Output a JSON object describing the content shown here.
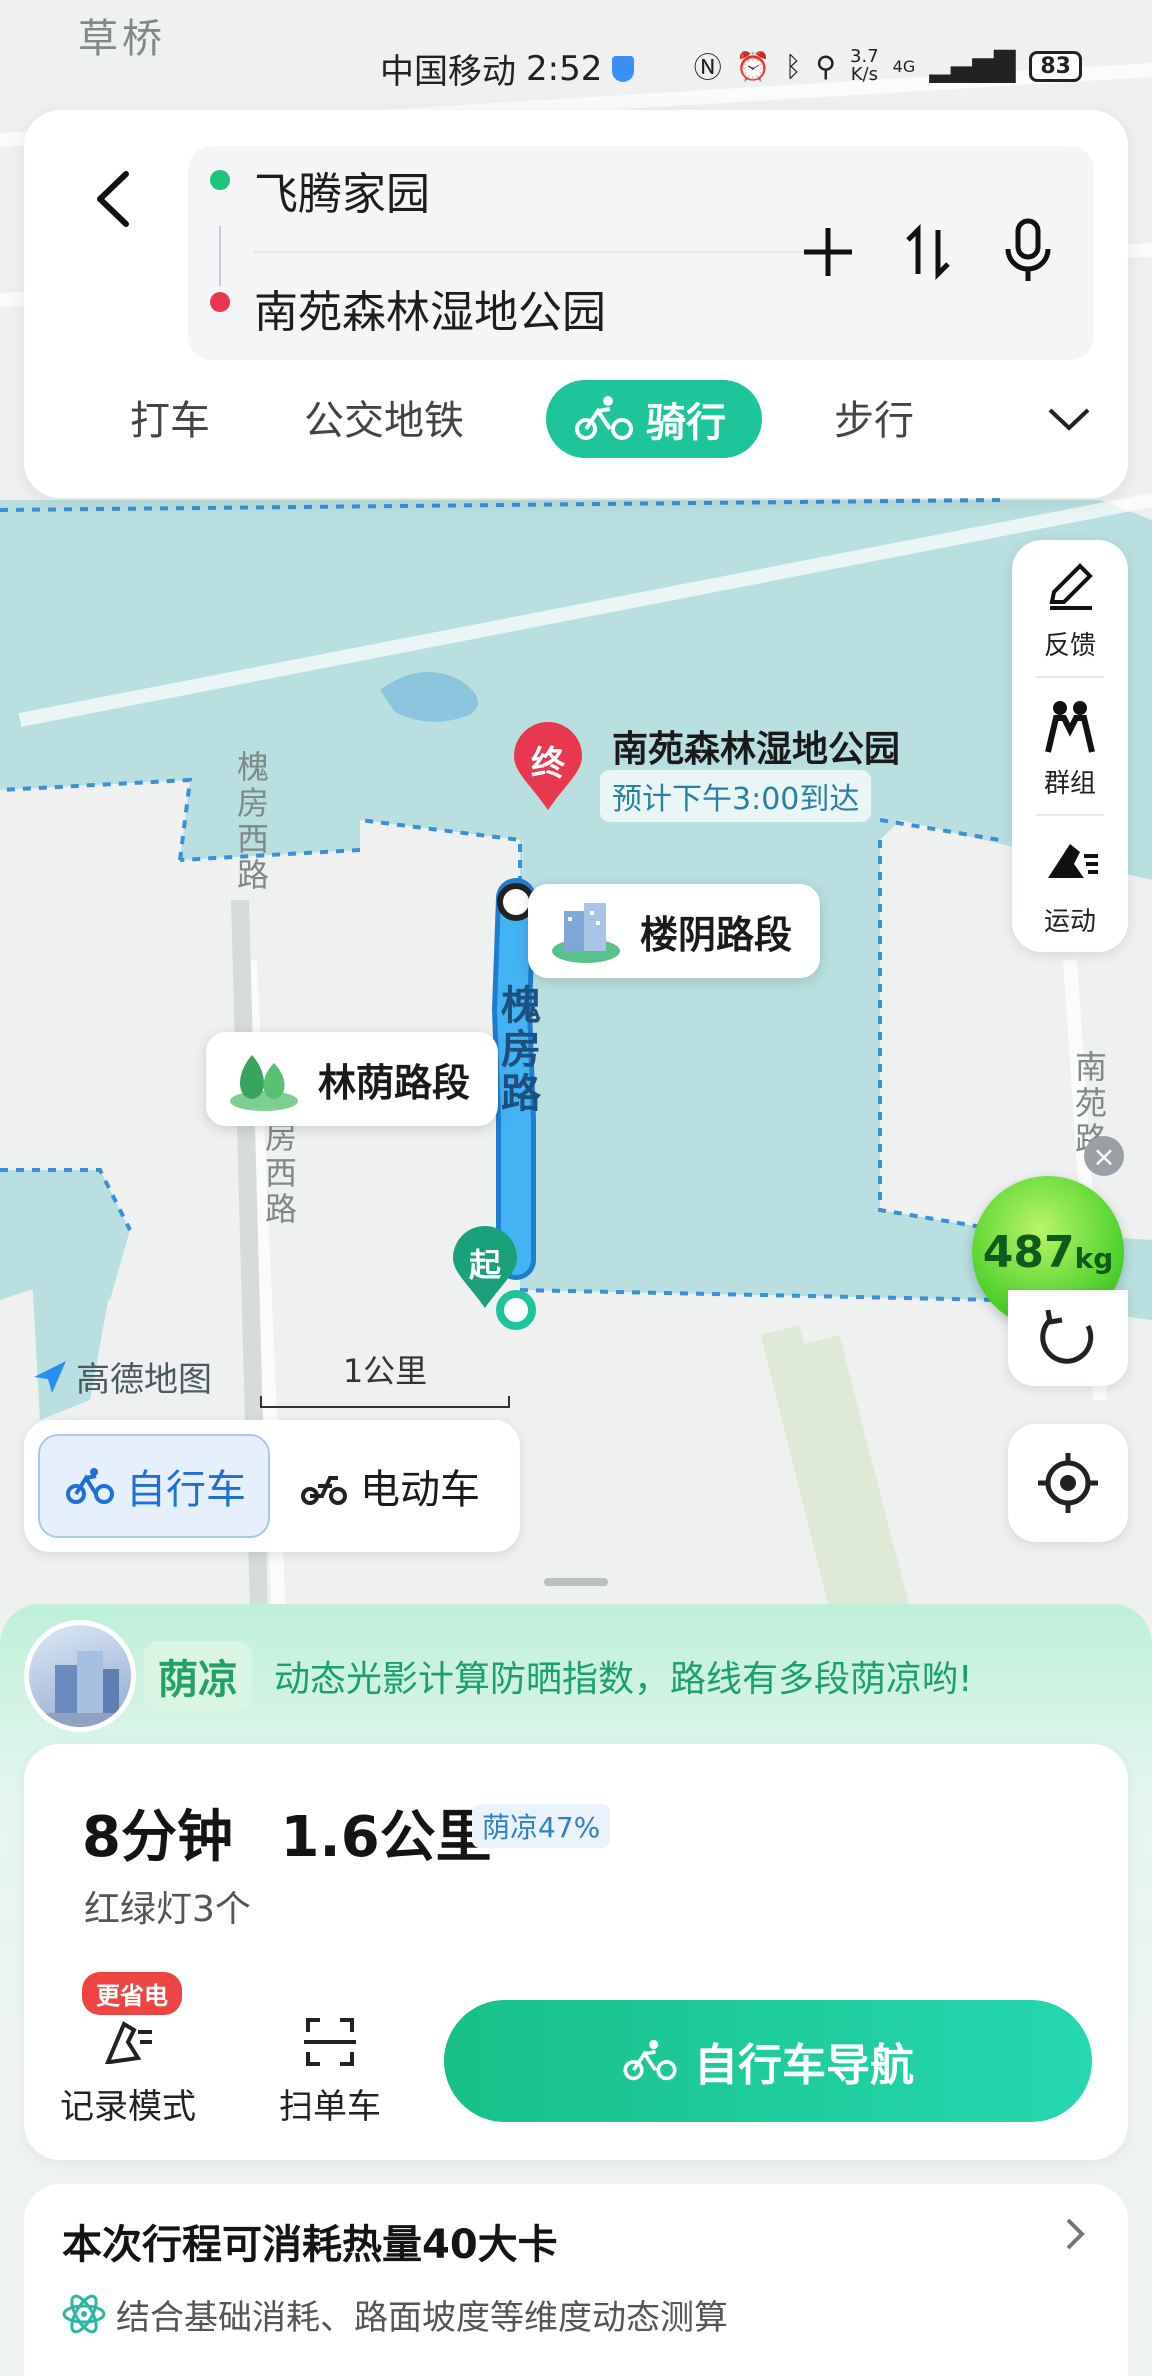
{
  "status_bar": {
    "carrier": "中国移动",
    "time": "2:52",
    "speed_value": "3.7",
    "speed_unit": "K/s",
    "network": "4G",
    "battery": "83"
  },
  "route_card": {
    "origin": "飞腾家园",
    "destination": "南苑森林湿地公园",
    "modes": [
      "打车",
      "公交地铁",
      "骑行",
      "步行"
    ],
    "active_mode": "骑行"
  },
  "map": {
    "district_label": "草桥",
    "road_labels": [
      "槐房西路",
      "房西路",
      "南苑路",
      "槐房路"
    ],
    "destination_name": "南苑森林湿地公园",
    "destination_eta": "预计下午3:00到达",
    "destination_marker": "终",
    "start_marker": "起",
    "segment_tags": [
      "楼阴路段",
      "林荫路段"
    ],
    "carbon_value": "487",
    "carbon_unit": "kg",
    "logo_text": "高德地图",
    "scale_text": "1公里"
  },
  "tools": [
    {
      "label": "反馈",
      "icon": "pen-icon"
    },
    {
      "label": "群组",
      "icon": "group-icon"
    },
    {
      "label": "运动",
      "icon": "run-icon"
    }
  ],
  "bike_types": [
    "自行车",
    "电动车"
  ],
  "active_bike_type": "自行车",
  "shade": {
    "tag": "荫凉",
    "description": "动态光影计算防晒指数，路线有多段荫凉哟!"
  },
  "route_info": {
    "duration": "8分钟",
    "distance": "1.6公里",
    "shade_percent": "荫凉47%",
    "traffic_lights": "红绿灯3个",
    "record_mode_label": "记录模式",
    "power_badge": "更省电",
    "scan_bike_label": "扫单车",
    "navigate_label": "自行车导航"
  },
  "calories": {
    "title": "本次行程可消耗热量40大卡",
    "description": "结合基础消耗、路面坡度等维度动态测算"
  },
  "colors": {
    "accent_green": "#1ec49a",
    "route_blue": "#3aa6f0",
    "water": "#b9dfe0",
    "marker_red": "#e8384f"
  }
}
